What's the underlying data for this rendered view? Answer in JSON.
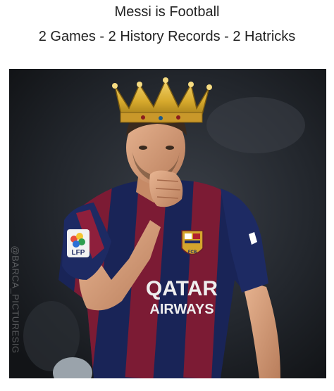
{
  "caption": {
    "title": "Messi is Football",
    "subtitle": "2 Games - 2 History Records - 2 Hatricks"
  },
  "photo": {
    "watermark": "@BARCA_PICTURESIG",
    "sponsor_line1": "QATAR",
    "sponsor_line2": "AIRWAYS",
    "sleeve_badge": "LFP",
    "crest_text": "FCB",
    "colors": {
      "background": "#1a1d22",
      "kit_blue": "#1d2a63",
      "kit_red": "#8e1f3c",
      "crown_gold": "#d6a92c",
      "skin": "#d9a07c",
      "hair": "#3a2a1e"
    }
  }
}
